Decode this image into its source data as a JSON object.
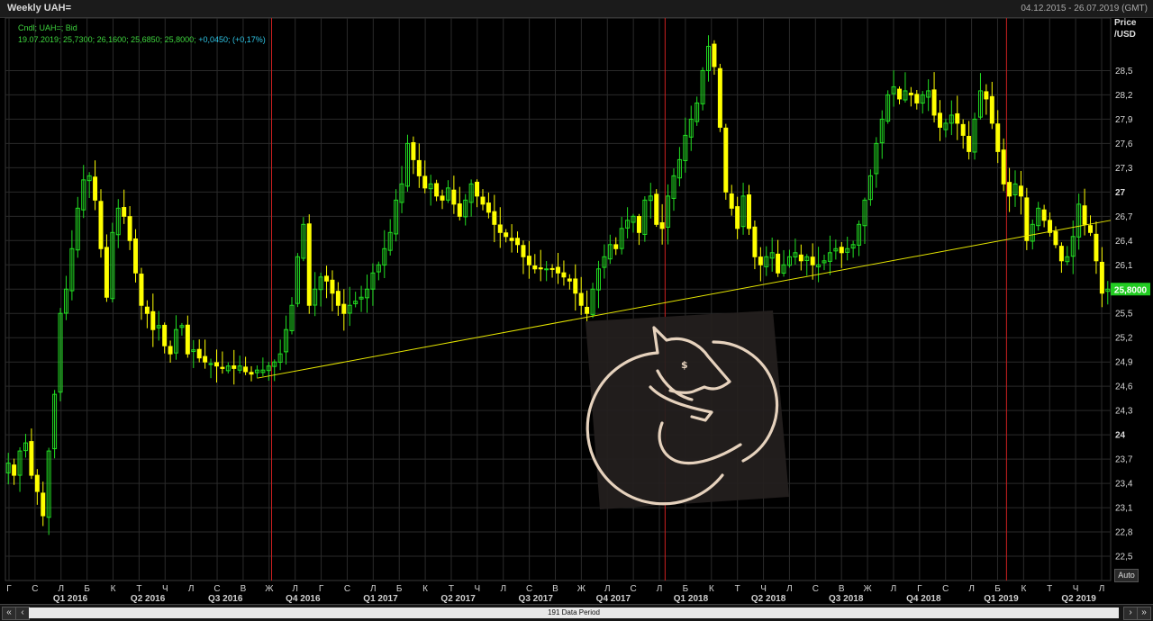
{
  "window": {
    "title": "Weekly UAH=",
    "date_range": "04.12.2015 - 26.07.2019 (GMT)"
  },
  "legend": {
    "line1": "Cndl; UAH=; Bid",
    "line2_values": "19.07.2019; 25,7300; 26,1600; 25,6850; 25,8000;",
    "line2_change": "+0,0450; (+0,17%)"
  },
  "axis": {
    "ylabel_line1": "Price",
    "ylabel_line2": "/USD",
    "auto_label": "Auto",
    "last_price_label": "25,8000"
  },
  "scrollbar": {
    "label": "191 Data Period",
    "left_buttons": [
      "«",
      "‹"
    ],
    "right_buttons": [
      "›",
      "»"
    ]
  },
  "colors": {
    "background": "#000000",
    "grid": "#2a2a2a",
    "up_candle": "#22dd22",
    "down_candle": "#ffff00",
    "trendline": "#e6e600",
    "quarter_divider": "#cc2020",
    "last_price_bg": "#22cc22"
  },
  "watermark": {
    "icon": "dog-coin-logo-icon"
  },
  "chart_data": {
    "type": "candlestick",
    "series_label": "Cndl; UAH=; Bid",
    "period": "weekly",
    "n_periods": 191,
    "ylim": [
      22.2,
      29.15
    ],
    "yticks": [
      "22,5",
      "22,8",
      "23,1",
      "23,4",
      "23,7",
      "24",
      "24,3",
      "24,6",
      "24,9",
      "25,2",
      "25,5",
      "25,8",
      "26,1",
      "26,4",
      "26,7",
      "27",
      "27,3",
      "27,6",
      "27,9",
      "28,2",
      "28,5"
    ],
    "bold_yticks": [
      "24",
      "27"
    ],
    "month_labels": [
      "Г",
      "С",
      "Л",
      "Б",
      "К",
      "Т",
      "Ч",
      "Л",
      "С",
      "В",
      "Ж",
      "Л",
      "Г",
      "С",
      "Л",
      "Б",
      "К",
      "Т",
      "Ч",
      "Л",
      "С",
      "В",
      "Ж",
      "Л",
      "С",
      "Л",
      "Б",
      "К",
      "Т",
      "Ч",
      "Л",
      "С",
      "В",
      "Ж",
      "Л",
      "Г",
      "С",
      "Л",
      "Б",
      "К",
      "Т",
      "Ч",
      "Л"
    ],
    "quarter_labels": [
      "Q1 2016",
      "Q2 2016",
      "Q3 2016",
      "Q4 2016",
      "Q1 2017",
      "Q2 2017",
      "Q3 2017",
      "Q4 2017",
      "Q1 2018",
      "Q2 2018",
      "Q3 2018",
      "Q4 2018",
      "Q1 2019",
      "Q2 2019"
    ],
    "divider_positions_week": [
      46,
      114,
      173
    ],
    "last_close": 25.8,
    "trendline": {
      "from": {
        "week": 43,
        "price": 24.7
      },
      "to": {
        "week": 190,
        "price": 26.65
      }
    },
    "close_path": [
      [
        0,
        23.65
      ],
      [
        1,
        23.5
      ],
      [
        2,
        23.8
      ],
      [
        3,
        23.9
      ],
      [
        4,
        23.5
      ],
      [
        5,
        23.3
      ],
      [
        6,
        23.0
      ],
      [
        7,
        23.8
      ],
      [
        8,
        24.5
      ],
      [
        9,
        25.5
      ],
      [
        10,
        25.8
      ],
      [
        11,
        26.3
      ],
      [
        12,
        26.8
      ],
      [
        13,
        27.15
      ],
      [
        14,
        27.2
      ],
      [
        15,
        26.9
      ],
      [
        16,
        26.3
      ],
      [
        17,
        25.7
      ],
      [
        18,
        26.5
      ],
      [
        19,
        26.8
      ],
      [
        20,
        26.7
      ],
      [
        21,
        26.4
      ],
      [
        22,
        26.0
      ],
      [
        23,
        25.6
      ],
      [
        24,
        25.5
      ],
      [
        25,
        25.3
      ],
      [
        26,
        25.35
      ],
      [
        27,
        25.1
      ],
      [
        28,
        25.0
      ],
      [
        29,
        25.3
      ],
      [
        30,
        25.35
      ],
      [
        31,
        25.0
      ],
      [
        32,
        25.05
      ],
      [
        33,
        24.95
      ],
      [
        34,
        24.9
      ],
      [
        35,
        24.88
      ],
      [
        36,
        24.85
      ],
      [
        37,
        24.82
      ],
      [
        38,
        24.85
      ],
      [
        39,
        24.82
      ],
      [
        40,
        24.85
      ],
      [
        41,
        24.78
      ],
      [
        42,
        24.75
      ],
      [
        43,
        24.8
      ],
      [
        44,
        24.8
      ],
      [
        45,
        24.85
      ],
      [
        46,
        24.9
      ],
      [
        47,
        25.0
      ],
      [
        48,
        25.3
      ],
      [
        49,
        25.6
      ],
      [
        50,
        26.2
      ],
      [
        51,
        26.6
      ],
      [
        52,
        25.6
      ],
      [
        53,
        25.8
      ],
      [
        54,
        25.95
      ],
      [
        55,
        25.9
      ],
      [
        56,
        25.75
      ],
      [
        57,
        25.6
      ],
      [
        58,
        25.5
      ],
      [
        59,
        25.6
      ],
      [
        60,
        25.65
      ],
      [
        61,
        25.7
      ],
      [
        62,
        25.8
      ],
      [
        63,
        26.0
      ],
      [
        64,
        26.1
      ],
      [
        65,
        26.3
      ],
      [
        66,
        26.5
      ],
      [
        67,
        26.9
      ],
      [
        68,
        27.1
      ],
      [
        69,
        27.6
      ],
      [
        70,
        27.4
      ],
      [
        71,
        27.2
      ],
      [
        72,
        27.05
      ],
      [
        73,
        27.1
      ],
      [
        74,
        26.95
      ],
      [
        75,
        26.9
      ],
      [
        76,
        27.05
      ],
      [
        77,
        26.85
      ],
      [
        78,
        26.7
      ],
      [
        79,
        26.9
      ],
      [
        80,
        27.1
      ],
      [
        81,
        26.95
      ],
      [
        82,
        26.85
      ],
      [
        83,
        26.75
      ],
      [
        84,
        26.6
      ],
      [
        85,
        26.5
      ],
      [
        86,
        26.45
      ],
      [
        87,
        26.4
      ],
      [
        88,
        26.35
      ],
      [
        89,
        26.2
      ],
      [
        90,
        26.1
      ],
      [
        91,
        26.05
      ],
      [
        92,
        26.05
      ],
      [
        93,
        26.05
      ],
      [
        94,
        26.05
      ],
      [
        95,
        26.0
      ],
      [
        96,
        25.95
      ],
      [
        97,
        25.9
      ],
      [
        98,
        25.75
      ],
      [
        99,
        25.6
      ],
      [
        100,
        25.5
      ],
      [
        101,
        25.8
      ],
      [
        102,
        26.05
      ],
      [
        103,
        26.2
      ],
      [
        104,
        26.35
      ],
      [
        105,
        26.3
      ],
      [
        106,
        26.55
      ],
      [
        107,
        26.65
      ],
      [
        108,
        26.7
      ],
      [
        109,
        26.5
      ],
      [
        110,
        26.9
      ],
      [
        111,
        26.95
      ],
      [
        112,
        26.6
      ],
      [
        113,
        26.55
      ],
      [
        114,
        26.95
      ],
      [
        115,
        27.2
      ],
      [
        116,
        27.4
      ],
      [
        117,
        27.7
      ],
      [
        118,
        27.9
      ],
      [
        119,
        28.1
      ],
      [
        120,
        28.5
      ],
      [
        121,
        28.8
      ],
      [
        122,
        28.55
      ],
      [
        123,
        27.8
      ],
      [
        124,
        27.0
      ],
      [
        125,
        26.8
      ],
      [
        126,
        26.55
      ],
      [
        127,
        26.95
      ],
      [
        128,
        26.55
      ],
      [
        129,
        26.2
      ],
      [
        130,
        26.1
      ],
      [
        131,
        26.2
      ],
      [
        132,
        26.25
      ],
      [
        133,
        26.0
      ],
      [
        134,
        26.1
      ],
      [
        135,
        26.2
      ],
      [
        136,
        26.25
      ],
      [
        137,
        26.15
      ],
      [
        138,
        26.2
      ],
      [
        139,
        26.1
      ],
      [
        140,
        26.1
      ],
      [
        141,
        26.15
      ],
      [
        142,
        26.25
      ],
      [
        143,
        26.3
      ],
      [
        144,
        26.25
      ],
      [
        145,
        26.3
      ],
      [
        146,
        26.35
      ],
      [
        147,
        26.6
      ],
      [
        148,
        26.9
      ],
      [
        149,
        27.2
      ],
      [
        150,
        27.6
      ],
      [
        151,
        27.9
      ],
      [
        152,
        28.2
      ],
      [
        153,
        28.3
      ],
      [
        154,
        28.15
      ],
      [
        155,
        28.25
      ],
      [
        156,
        28.2
      ],
      [
        157,
        28.1
      ],
      [
        158,
        28.2
      ],
      [
        159,
        28.25
      ],
      [
        160,
        27.95
      ],
      [
        161,
        27.8
      ],
      [
        162,
        27.85
      ],
      [
        163,
        27.95
      ],
      [
        164,
        27.85
      ],
      [
        165,
        27.7
      ],
      [
        166,
        27.5
      ],
      [
        167,
        27.9
      ],
      [
        168,
        28.25
      ],
      [
        169,
        28.15
      ],
      [
        170,
        27.85
      ],
      [
        171,
        27.5
      ],
      [
        172,
        27.1
      ],
      [
        173,
        26.95
      ],
      [
        174,
        27.1
      ],
      [
        175,
        26.95
      ],
      [
        176,
        26.4
      ],
      [
        177,
        26.6
      ],
      [
        178,
        26.8
      ],
      [
        179,
        26.65
      ],
      [
        180,
        26.5
      ],
      [
        181,
        26.35
      ],
      [
        182,
        26.15
      ],
      [
        183,
        26.2
      ],
      [
        184,
        26.45
      ],
      [
        185,
        26.85
      ],
      [
        186,
        26.6
      ],
      [
        187,
        26.5
      ],
      [
        188,
        26.15
      ],
      [
        189,
        25.75
      ],
      [
        190,
        25.8
      ]
    ]
  }
}
